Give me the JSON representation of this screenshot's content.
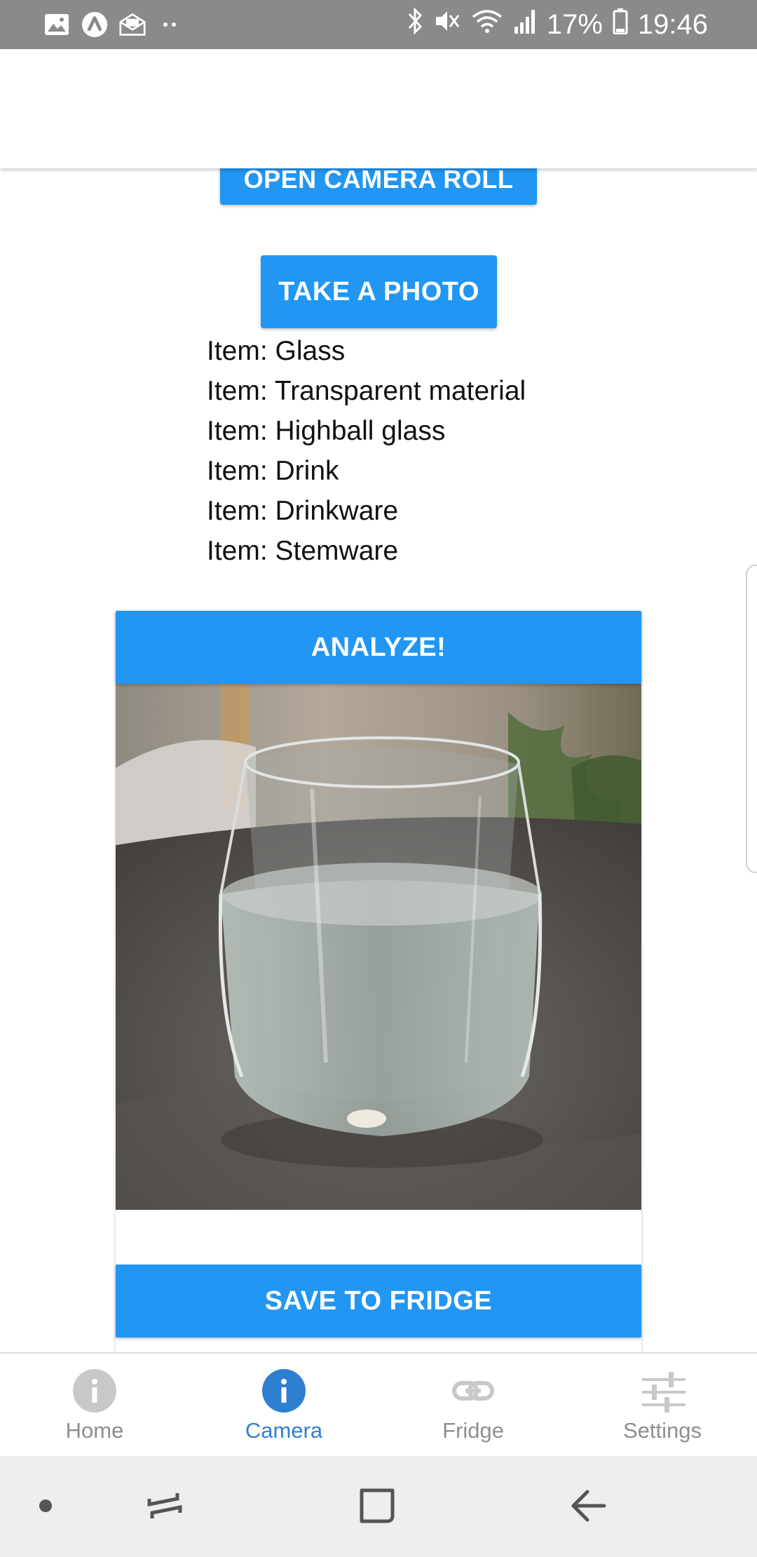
{
  "status_bar": {
    "battery_text": "17%",
    "time": "19:46",
    "left_icons": [
      "gallery-icon",
      "app-a-icon",
      "mail-icon",
      "more-dots-icon"
    ],
    "right_icons": [
      "bluetooth-icon",
      "mute-icon",
      "wifi-icon",
      "signal-icon",
      "battery-icon"
    ]
  },
  "buttons": {
    "camera_roll": "OPEN CAMERA ROLL",
    "take_photo": "TAKE A PHOTO",
    "analyze": "ANALYZE!",
    "save": "SAVE TO FRIDGE"
  },
  "items": [
    "Item: Glass",
    "Item: Transparent material",
    "Item: Highball glass",
    "Item: Drink",
    "Item: Drinkware",
    "Item: Stemware"
  ],
  "photo": {
    "subject": "glass-of-water-photo"
  },
  "tabs": [
    {
      "label": "Home",
      "icon": "info-icon",
      "active": false
    },
    {
      "label": "Camera",
      "icon": "info-icon",
      "active": true
    },
    {
      "label": "Fridge",
      "icon": "link-icon",
      "active": false
    },
    {
      "label": "Settings",
      "icon": "sliders-icon",
      "active": false
    }
  ],
  "colors": {
    "accent": "#2196f3",
    "active_tab": "#2f7fd1",
    "inactive_tab": "#8e8e93",
    "status_bar": "#8a8a8a"
  }
}
